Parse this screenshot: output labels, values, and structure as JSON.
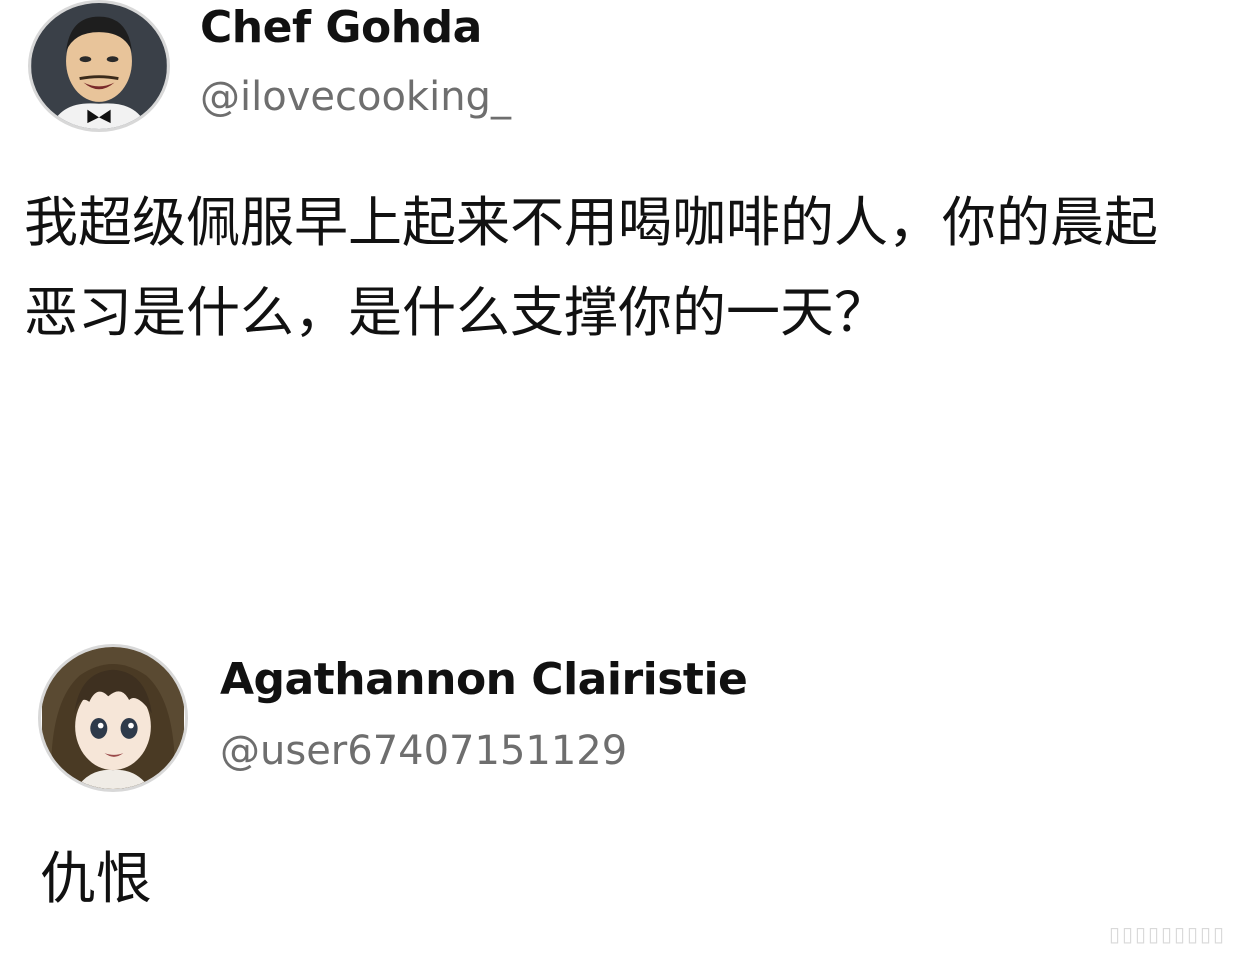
{
  "posts": [
    {
      "author": {
        "display_name": "Chef Gohda",
        "handle": "@ilovecooking_",
        "avatar_icon": "chef-avatar-icon"
      },
      "text": "我超级佩服早上起来不用喝咖啡的人，你的晨起恶习是什么，是什么支撑你的一天？"
    },
    {
      "author": {
        "display_name": "Agathannon Clairistie",
        "handle": "@user67407151129",
        "avatar_icon": "anime-girl-avatar-icon"
      },
      "text": "仇恨"
    }
  ],
  "colors": {
    "background": "#ffffff",
    "name_text": "#111111",
    "handle_text": "#6e6e6e"
  }
}
